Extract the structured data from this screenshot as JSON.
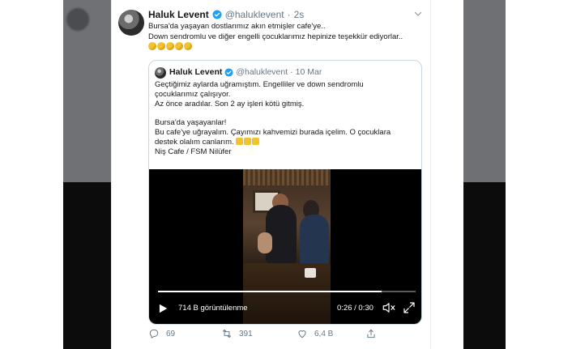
{
  "tweet": {
    "author_name": "Haluk Levent",
    "author_handle": "@haluklevent",
    "separator": "·",
    "time": "2s",
    "text_lines": [
      "Bursa'da yaşayan dostlarımız akın etmişler cafe'ye..",
      "Down sendromlu ve diğer engelli çocuklarımız hepinize teşekkür ediyorlar.."
    ],
    "emoji_icons": [
      "clapping-hands-icon",
      "clapping-hands-icon",
      "clapping-hands-icon",
      "clapping-hands-icon",
      "clapping-hands-icon"
    ]
  },
  "quoted_tweet": {
    "author_name": "Haluk Levent",
    "author_handle": "@haluklevent",
    "separator": "·",
    "date": "10 Mar",
    "lines": [
      "Geçtiğimiz aylarda uğramıştım. Engelliler ve down sendromlu",
      "çocuklarımız çalışıyor.",
      "Az önce aradılar. Son 2 ay işleri kötü gitmiş.",
      "",
      "Bursa'da yaşayanlar!",
      "Bu cafe'ye uğrayalım. Çayımızı kahvemizi burada içelim. O çocuklara",
      "destek olalım canlarım.",
      "Niş Cafe / FSM Nilüfer"
    ],
    "pray_icons": [
      "folded-hands-icon",
      "folded-hands-icon",
      "folded-hands-icon"
    ]
  },
  "video": {
    "views": "714 B görüntülenme",
    "duration": "0:26 / 0:30",
    "progress": 0.867,
    "icons": [
      "play-icon",
      "volume-icon",
      "fullscreen-icon"
    ]
  },
  "actions": {
    "reply_count": "69",
    "retweet_count": "391",
    "like_count": "6,4 B",
    "icons": [
      "reply-icon",
      "retweet-icon",
      "like-icon",
      "share-icon"
    ]
  },
  "colors": {
    "text": "#14171a",
    "secondary": "#657786",
    "verified": "#1da1f2",
    "border": "#ccd6dd"
  }
}
